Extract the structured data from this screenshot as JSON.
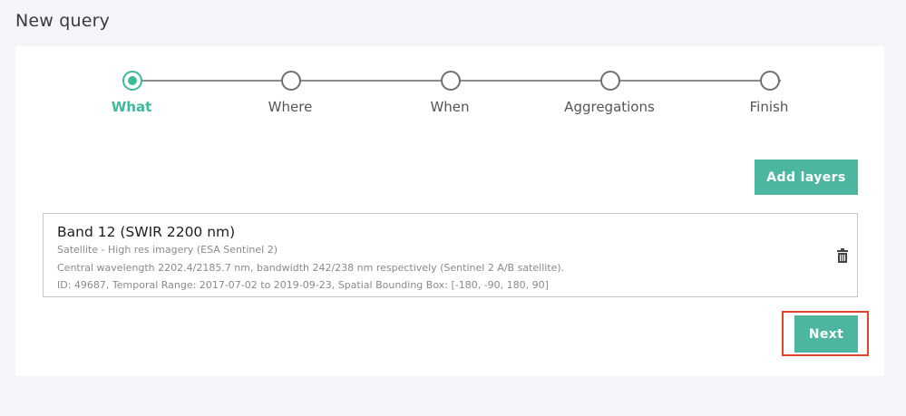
{
  "page": {
    "title": "New query"
  },
  "stepper": {
    "steps": [
      {
        "label": "What",
        "active": true
      },
      {
        "label": "Where",
        "active": false
      },
      {
        "label": "When",
        "active": false
      },
      {
        "label": "Aggregations",
        "active": false
      },
      {
        "label": "Finish",
        "active": false
      }
    ]
  },
  "toolbar": {
    "add_layers_label": "Add layers"
  },
  "layer": {
    "title": "Band 12 (SWIR 2200 nm)",
    "source": "Satellite - High res imagery (ESA Sentinel 2)",
    "description": "Central wavelength 2202.4/2185.7 nm, bandwidth 242/238 nm respectively (Sentinel 2 A/B satellite).",
    "details": "ID: 49687, Temporal Range: 2017-07-02 to 2019-09-23, Spatial Bounding Box: [-180, -90, 180, 90]",
    "delete_icon": "trash-icon"
  },
  "footer": {
    "next_label": "Next"
  },
  "colors": {
    "accent": "#4db6a0",
    "active_step": "#3fb89b",
    "highlight": "#e0442b"
  }
}
